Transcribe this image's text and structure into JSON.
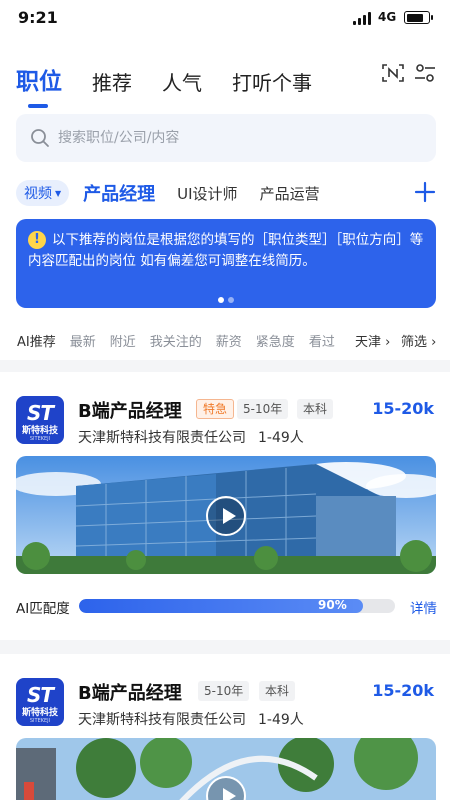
{
  "status": {
    "time": "9:21",
    "network": "4G"
  },
  "tabs": [
    "职位",
    "推荐",
    "人气",
    "打听个事"
  ],
  "icons": {
    "scan": "scan-icon",
    "filter": "filter-settings-icon",
    "search": "search-icon",
    "add": "plus-icon"
  },
  "search": {
    "placeholder": "搜索职位/公司/内容"
  },
  "categories": {
    "dropdown": "视频",
    "items": [
      "产品经理",
      "UI设计师",
      "产品运营"
    ]
  },
  "banner": {
    "text": "以下推荐的岗位是根据您的填写的［职位类型］［职位方向］等内容匹配出的岗位 如有偏差您可调整在线简历。",
    "page": 1,
    "pages": 2
  },
  "filters": {
    "items": [
      "AI推荐",
      "最新",
      "附近",
      "我关注的",
      "薪资",
      "紧急度",
      "看过"
    ],
    "city": "天津 ›",
    "screen": "筛选 ›"
  },
  "colors": {
    "accent": "#1e5ae6",
    "urgent": "#f07a2a"
  },
  "jobs": [
    {
      "logo": {
        "mark": "ST",
        "name": "斯特科技",
        "sub": "SITEKEJI"
      },
      "title": "B端产品经理",
      "urgent": "特急",
      "experience": "5-10年",
      "education": "本科",
      "salary": "15-20k",
      "company": "天津斯特科技有限责任公司",
      "size": "1-49人",
      "match_label": "AI匹配度",
      "match_percent": 90,
      "match_text": "90%",
      "detail": "详情"
    },
    {
      "logo": {
        "mark": "ST",
        "name": "斯特科技",
        "sub": "SITEKEJI"
      },
      "title": "B端产品经理",
      "experience": "5-10年",
      "education": "本科",
      "salary": "15-20k",
      "company": "天津斯特科技有限责任公司",
      "size": "1-49人"
    }
  ]
}
